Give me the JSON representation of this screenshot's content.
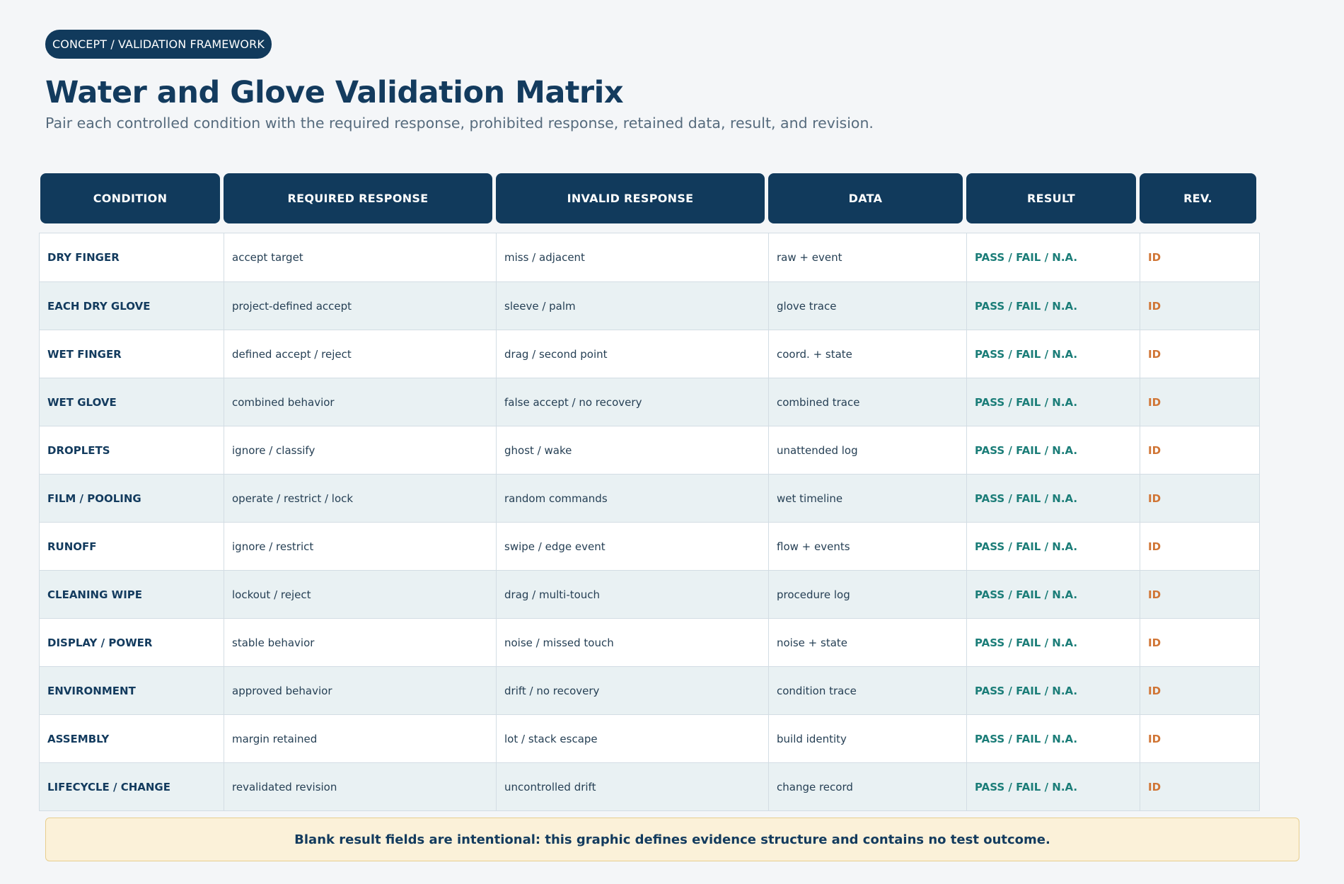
{
  "badge": "CONCEPT / VALIDATION FRAMEWORK",
  "title": "Water and Glove Validation Matrix",
  "subtitle": "Pair each controlled condition with the required response, prohibited response, retained data, result, and revision.",
  "headers": [
    "CONDITION",
    "REQUIRED RESPONSE",
    "INVALID RESPONSE",
    "DATA",
    "RESULT",
    "REV."
  ],
  "rows": [
    {
      "condition": "DRY FINGER",
      "required": "accept target",
      "invalid": "miss / adjacent",
      "data": "raw + event",
      "result": "PASS / FAIL / N.A.",
      "rev": "ID"
    },
    {
      "condition": "EACH DRY GLOVE",
      "required": "project-defined accept",
      "invalid": "sleeve / palm",
      "data": "glove trace",
      "result": "PASS / FAIL / N.A.",
      "rev": "ID"
    },
    {
      "condition": "WET FINGER",
      "required": "defined accept / reject",
      "invalid": "drag / second point",
      "data": "coord. + state",
      "result": "PASS / FAIL / N.A.",
      "rev": "ID"
    },
    {
      "condition": "WET GLOVE",
      "required": "combined behavior",
      "invalid": "false accept / no recovery",
      "data": "combined trace",
      "result": "PASS / FAIL / N.A.",
      "rev": "ID"
    },
    {
      "condition": "DROPLETS",
      "required": "ignore / classify",
      "invalid": "ghost / wake",
      "data": "unattended log",
      "result": "PASS / FAIL / N.A.",
      "rev": "ID"
    },
    {
      "condition": "FILM / POOLING",
      "required": "operate / restrict / lock",
      "invalid": "random commands",
      "data": "wet timeline",
      "result": "PASS / FAIL / N.A.",
      "rev": "ID"
    },
    {
      "condition": "RUNOFF",
      "required": "ignore / restrict",
      "invalid": "swipe / edge event",
      "data": "flow + events",
      "result": "PASS / FAIL / N.A.",
      "rev": "ID"
    },
    {
      "condition": "CLEANING WIPE",
      "required": "lockout / reject",
      "invalid": "drag / multi-touch",
      "data": "procedure log",
      "result": "PASS / FAIL / N.A.",
      "rev": "ID"
    },
    {
      "condition": "DISPLAY / POWER",
      "required": "stable behavior",
      "invalid": "noise / missed touch",
      "data": "noise + state",
      "result": "PASS / FAIL / N.A.",
      "rev": "ID"
    },
    {
      "condition": "ENVIRONMENT",
      "required": "approved behavior",
      "invalid": "drift / no recovery",
      "data": "condition trace",
      "result": "PASS / FAIL / N.A.",
      "rev": "ID"
    },
    {
      "condition": "ASSEMBLY",
      "required": "margin retained",
      "invalid": "lot / stack escape",
      "data": "build identity",
      "result": "PASS / FAIL / N.A.",
      "rev": "ID"
    },
    {
      "condition": "LIFECYCLE / CHANGE",
      "required": "revalidated revision",
      "invalid": "uncontrolled drift",
      "data": "change record",
      "result": "PASS / FAIL / N.A.",
      "rev": "ID"
    }
  ],
  "note": "Blank result fields are intentional: this graphic defines evidence structure and contains no test outcome.",
  "colors": {
    "navy": "#113a5c",
    "teal": "#1b7d78",
    "orange": "#d07535",
    "row_alt": "#e9f1f3",
    "note_bg": "#fbf1d9"
  }
}
